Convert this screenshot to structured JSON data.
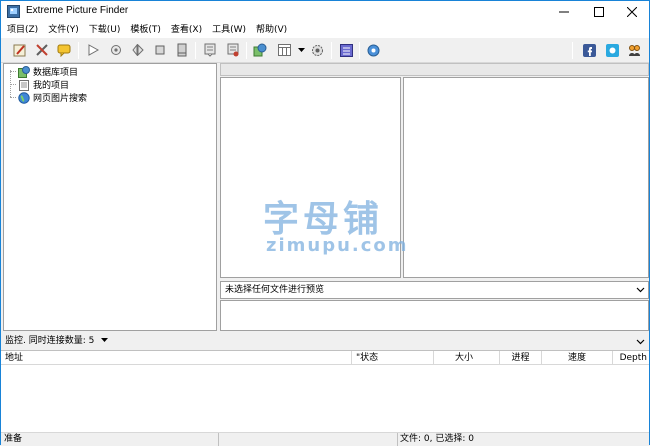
{
  "window": {
    "title": "Extreme Picture Finder"
  },
  "menu": [
    "项目(Z)",
    "文件(Y)",
    "下载(U)",
    "模板(T)",
    "查看(X)",
    "工具(W)",
    "帮助(V)"
  ],
  "tree": {
    "items": [
      "数据库项目",
      "我的项目",
      "网页图片搜索"
    ]
  },
  "preview": {
    "label": "未选择任何文件进行预览"
  },
  "watermark": {
    "big": "字母铺",
    "small": "zimupu.com"
  },
  "monitor": {
    "label": "监控. 同时连接数量: 5"
  },
  "table": {
    "columns": [
      "地址",
      "\"状态",
      "大小",
      "进程",
      "速度",
      "Depth"
    ]
  },
  "status": {
    "left": "准备",
    "right": "文件: 0, 已选择: 0"
  },
  "colors": {
    "accent": "#1883d7",
    "watermark": "#7fb1df"
  },
  "icons": [
    "new-project-icon",
    "tools-icon",
    "comment-icon",
    "play-icon",
    "settings-icon",
    "stop-icon",
    "database-icon",
    "save-icon",
    "template-icon",
    "template2-icon",
    "globe-image-icon",
    "view-icon",
    "gear-icon",
    "album-icon",
    "help-icon",
    "facebook-icon",
    "twitter-icon",
    "group-icon"
  ]
}
